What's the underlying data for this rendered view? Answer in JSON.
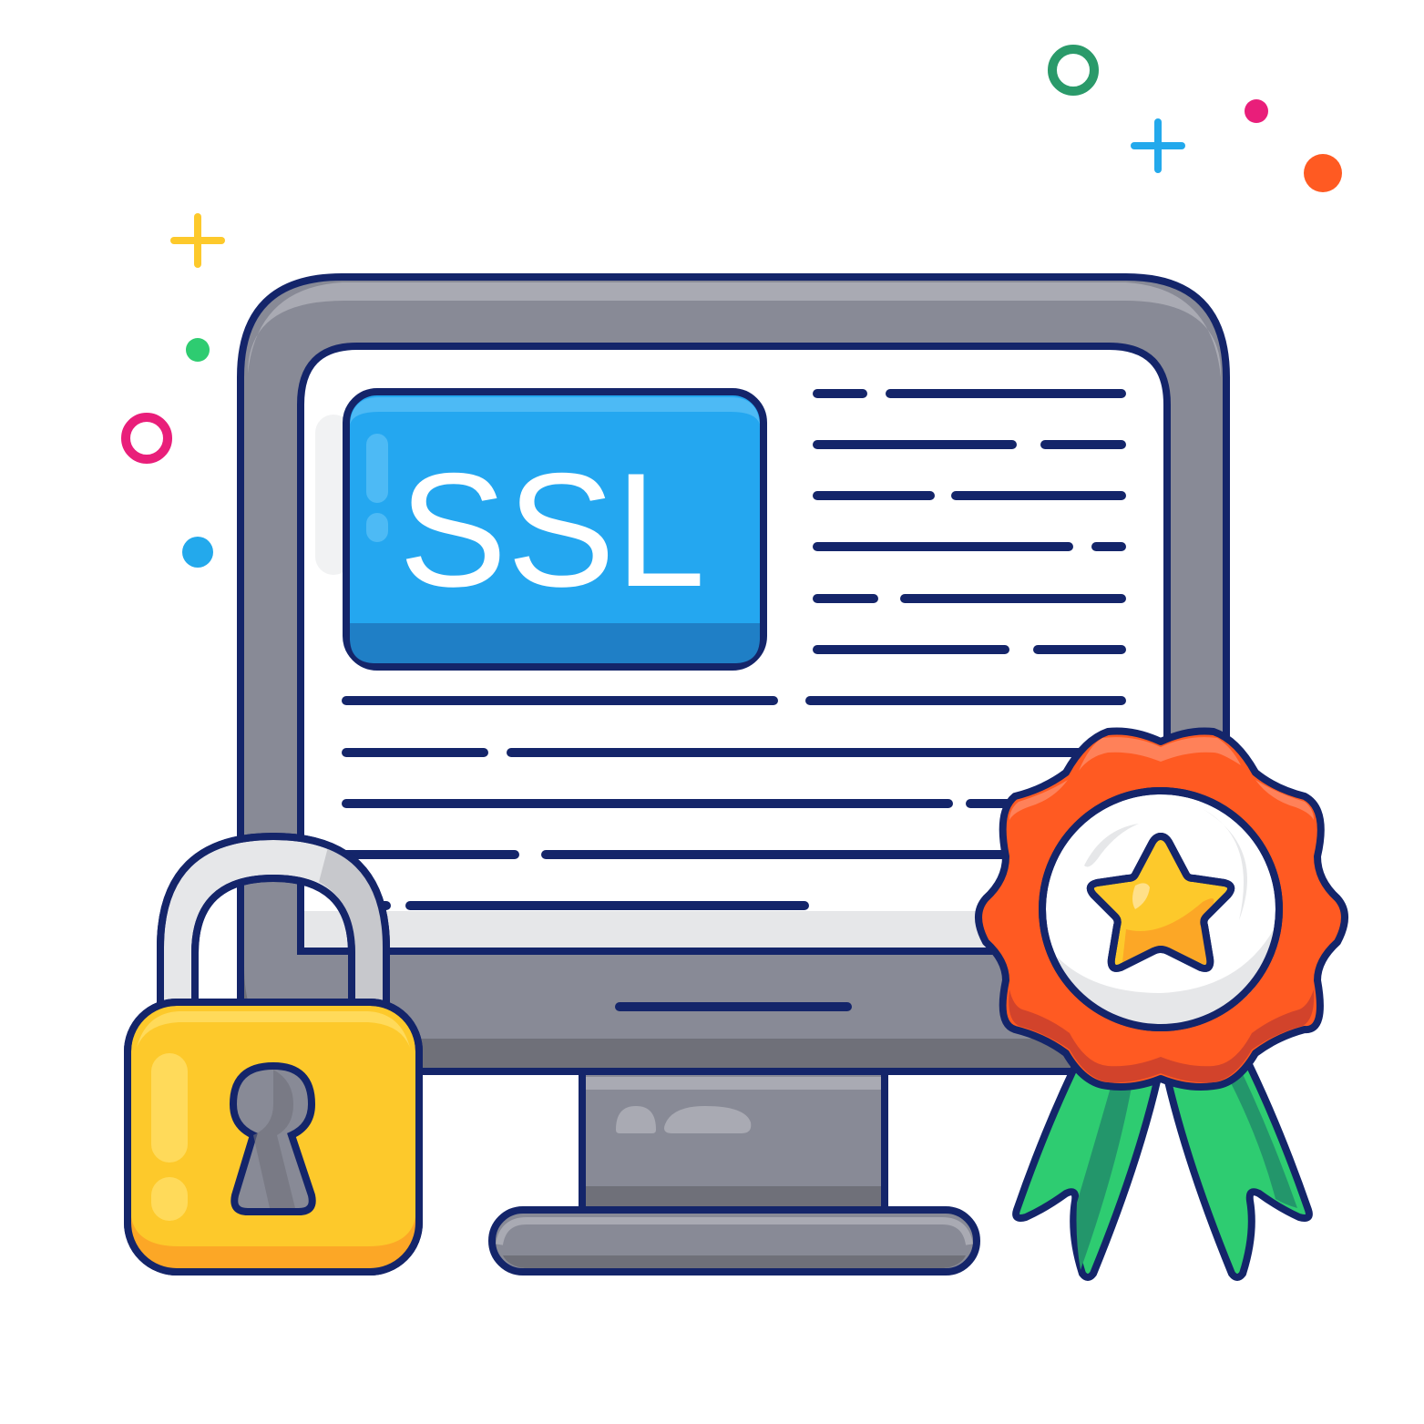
{
  "badge": {
    "text": "SSL"
  },
  "colors": {
    "outline": "#14256a",
    "monitor_frame": "#888a96",
    "monitor_frame_shade": "#6f7079",
    "monitor_frame_highlight": "#a9aab3",
    "screen": "#ffffff",
    "screen_bottom": "#e6e7e9",
    "ssl_blue": "#24a7f0",
    "ssl_blue_dark": "#1f7fc6",
    "ssl_blue_highlight": "#4dbaf5",
    "lock_body": "#fdc92b",
    "lock_body_shade": "#fca726",
    "lock_shackle": "#e6e7e9",
    "lock_shackle_shade": "#c7c8cc",
    "keyhole": "#888a96",
    "rosette": "#ff5a22",
    "rosette_shade": "#d2432b",
    "rosette_highlight": "#ff8159",
    "medal_disc": "#ffffff",
    "star": "#fdc92b",
    "star_shade": "#fca726",
    "ribbon": "#2ecc71",
    "ribbon_shade": "#23966b",
    "decor_green": "#2a9a6a",
    "decor_pink": "#e91e7a",
    "decor_blue": "#23a9ec",
    "decor_orange": "#ff5a22",
    "decor_yellow": "#fdc92b",
    "decor_bright_green": "#2ecc71"
  },
  "icons": {
    "monitor": "monitor-icon",
    "ssl_badge": "ssl-badge-icon",
    "padlock": "padlock-icon",
    "keyhole": "keyhole-icon",
    "award": "award-rosette-icon",
    "star": "star-icon",
    "ribbon": "ribbon-icon"
  }
}
